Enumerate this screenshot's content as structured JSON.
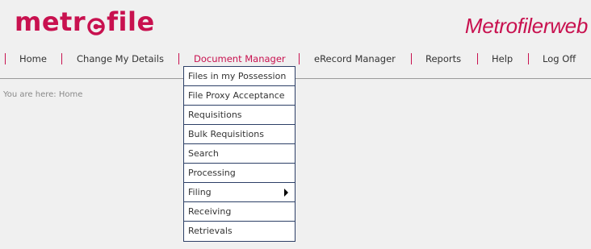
{
  "logo": {
    "text_before": "metr",
    "text_after": "file"
  },
  "brand_right": "Metrofilerweb",
  "nav": {
    "items": [
      {
        "label": "Home"
      },
      {
        "label": "Change My Details"
      },
      {
        "label": "Document Manager",
        "active": true
      },
      {
        "label": "eRecord Manager"
      },
      {
        "label": "Reports"
      },
      {
        "label": "Help"
      },
      {
        "label": "Log Off"
      }
    ]
  },
  "breadcrumb": "You are here: Home",
  "dropdown": {
    "items": [
      {
        "label": "Files in my Possession"
      },
      {
        "label": "File Proxy Acceptance"
      },
      {
        "label": "Requisitions"
      },
      {
        "label": "Bulk Requisitions"
      },
      {
        "label": "Search"
      },
      {
        "label": "Processing"
      },
      {
        "label": "Filing",
        "submenu": true
      },
      {
        "label": "Receiving"
      },
      {
        "label": "Retrievals"
      }
    ]
  },
  "colors": {
    "brand": "#c8114f",
    "menu_border": "#2c3f66",
    "text": "#333333"
  },
  "icons": {
    "logo_mark": "target-o-icon",
    "submenu": "caret-right-icon"
  }
}
